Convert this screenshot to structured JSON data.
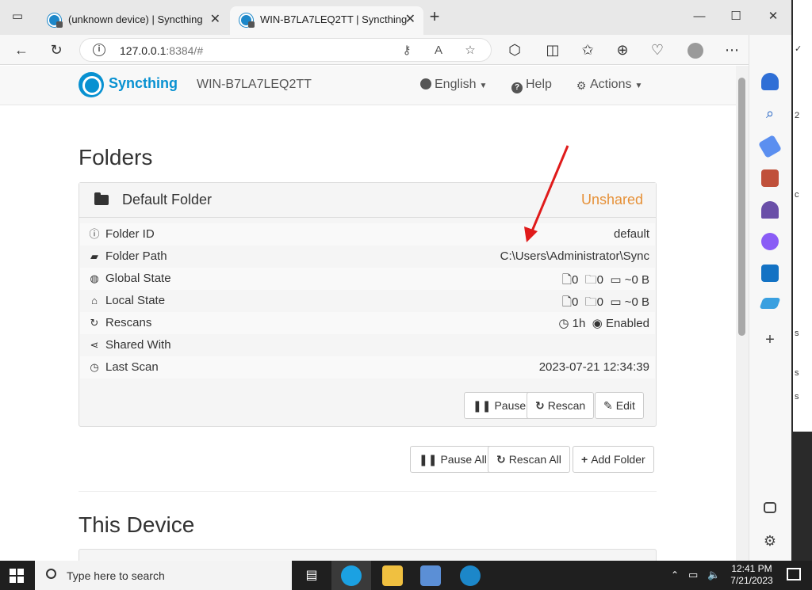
{
  "browser": {
    "tabs": [
      {
        "title": "(unknown device) | Syncthing",
        "active": false
      },
      {
        "title": "WIN-B7LA7LEQ2TT | Syncthing",
        "active": true
      }
    ],
    "new_tab": "+",
    "url_host": "127.0.0.1",
    "url_rest": ":8384/#",
    "window_buttons": {
      "minimize": "—",
      "maximize": "☐",
      "close": "✕"
    }
  },
  "header": {
    "brand": "Syncthing",
    "device_name": "WIN-B7LA7LEQ2TT",
    "language": "English",
    "help": "Help",
    "actions": "Actions"
  },
  "folders_section": {
    "title": "Folders",
    "folder": {
      "name": "Default Folder",
      "status": "Unshared",
      "rows": [
        {
          "label": "Folder ID",
          "value": "default",
          "icon": "info-icon"
        },
        {
          "label": "Folder Path",
          "value": "C:\\Users\\Administrator\\Sync",
          "icon": "folder-open-icon"
        },
        {
          "label": "Global State",
          "files": "0",
          "dirs": "0",
          "size": "~0 B",
          "icon": "globe-icon"
        },
        {
          "label": "Local State",
          "files": "0",
          "dirs": "0",
          "size": "~0 B",
          "icon": "home-icon"
        },
        {
          "label": "Rescans",
          "interval": "1h",
          "watch": "Enabled",
          "icon": "refresh-icon"
        },
        {
          "label": "Shared With",
          "value": "",
          "icon": "share-icon"
        },
        {
          "label": "Last Scan",
          "value": "2023-07-21 12:34:39",
          "icon": "clock-icon"
        }
      ],
      "buttons": {
        "pause": "Pause",
        "rescan": "Rescan",
        "edit": "Edit"
      }
    },
    "global_buttons": {
      "pause_all": "Pause All",
      "rescan_all": "Rescan All",
      "add_folder": "Add Folder"
    }
  },
  "this_device": {
    "title": "This Device"
  },
  "taskbar": {
    "search_placeholder": "Type here to search",
    "time": "12:41 PM",
    "date": "7/21/2023"
  },
  "colors": {
    "brand": "#0891d1",
    "unshared": "#e69138",
    "arrow": "#e01b1b"
  }
}
